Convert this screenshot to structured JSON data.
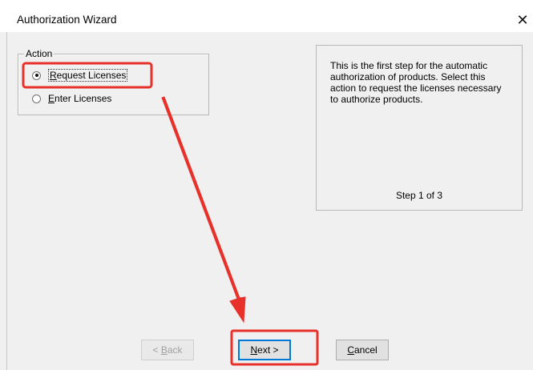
{
  "window": {
    "title": "Authorization Wizard",
    "close_glyph": "✕"
  },
  "action_group": {
    "label": "Action",
    "options": [
      {
        "label": "Request Licenses",
        "selected": true
      },
      {
        "label": "Enter Licenses",
        "selected": false
      }
    ]
  },
  "info_panel": {
    "description": "This is the first step for the automatic authorization of products.  Select this action to request the licenses necessary to authorize products.",
    "step": "Step 1 of 3"
  },
  "buttons": {
    "back": "< Back",
    "next": "Next >",
    "cancel": "Cancel"
  },
  "annotation": {
    "color": "#e8312a"
  }
}
